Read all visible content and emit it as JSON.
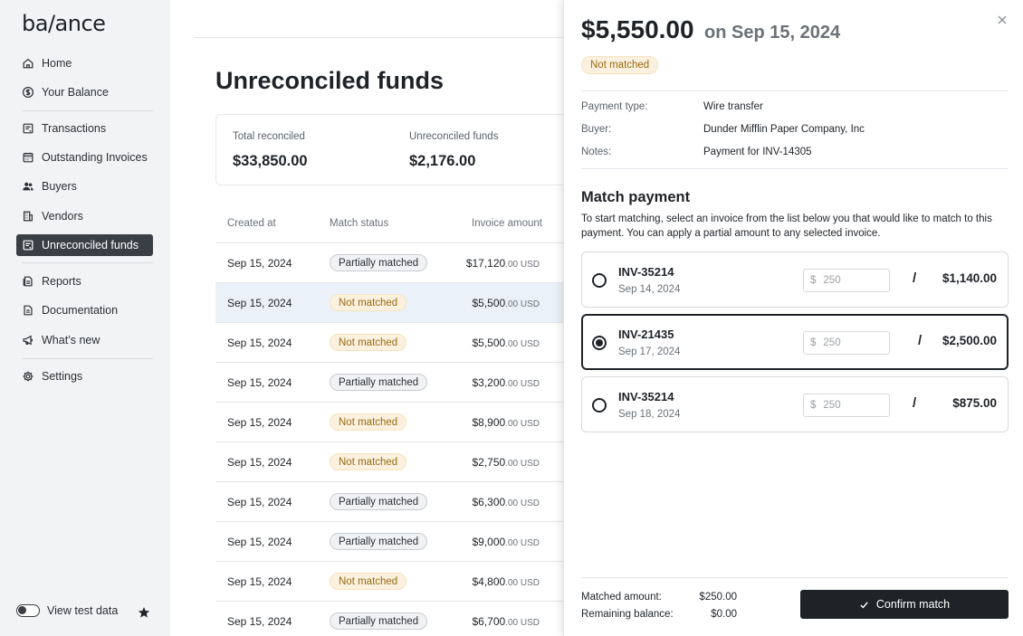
{
  "logo": "ba/ance",
  "sidebar": {
    "items": [
      {
        "label": "Home",
        "icon": "home-icon"
      },
      {
        "label": "Your Balance",
        "icon": "dollar-circle-icon"
      },
      {
        "label": "Transactions",
        "icon": "receipt-icon"
      },
      {
        "label": "Outstanding Invoices",
        "icon": "calendar-icon"
      },
      {
        "label": "Buyers",
        "icon": "users-icon"
      },
      {
        "label": "Vendors",
        "icon": "building-icon"
      },
      {
        "label": "Unreconciled funds",
        "icon": "funds-icon",
        "active": true
      },
      {
        "label": "Reports",
        "icon": "report-icon"
      },
      {
        "label": "Documentation",
        "icon": "document-icon"
      },
      {
        "label": "What’s new",
        "icon": "megaphone-icon"
      },
      {
        "label": "Settings",
        "icon": "gear-icon"
      }
    ],
    "test_data_label": "View test data"
  },
  "main": {
    "title": "Unreconciled funds",
    "stats": {
      "total_reconciled_label": "Total reconciled",
      "total_reconciled_value": "$33,850.00",
      "unreconciled_label": "Unreconciled funds",
      "unreconciled_value": "$2,176.00"
    },
    "table": {
      "headers": [
        "Created at",
        "Match status",
        "Invoice amount"
      ],
      "rows": [
        {
          "date": "Sep 15, 2024",
          "status": "Partially matched",
          "amount": "$17,120",
          "cents": ".00 USD"
        },
        {
          "date": "Sep 15, 2024",
          "status": "Not matched",
          "amount": "$5,500",
          "cents": ".00 USD"
        },
        {
          "date": "Sep 15, 2024",
          "status": "Not matched",
          "amount": "$5,500",
          "cents": ".00 USD"
        },
        {
          "date": "Sep 15, 2024",
          "status": "Partially matched",
          "amount": "$3,200",
          "cents": ".00 USD"
        },
        {
          "date": "Sep 15, 2024",
          "status": "Not matched",
          "amount": "$8,900",
          "cents": ".00 USD"
        },
        {
          "date": "Sep 15, 2024",
          "status": "Not matched",
          "amount": "$2,750",
          "cents": ".00 USD"
        },
        {
          "date": "Sep 15, 2024",
          "status": "Partially matched",
          "amount": "$6,300",
          "cents": ".00 USD"
        },
        {
          "date": "Sep 15, 2024",
          "status": "Partially matched",
          "amount": "$9,000",
          "cents": ".00 USD"
        },
        {
          "date": "Sep 15, 2024",
          "status": "Not matched",
          "amount": "$4,800",
          "cents": ".00 USD"
        },
        {
          "date": "Sep 15, 2024",
          "status": "Partially matched",
          "amount": "$6,700",
          "cents": ".00 USD"
        }
      ]
    }
  },
  "panel": {
    "amount": "$5,550.00",
    "date": "on Sep 15, 2024",
    "status": "Not matched",
    "details": [
      {
        "label": "Payment type:",
        "value": "Wire transfer"
      },
      {
        "label": "Buyer:",
        "value": "Dunder Mifflin Paper Company, Inc"
      },
      {
        "label": "Notes:",
        "value": "Payment for INV-14305"
      }
    ],
    "match_title": "Match payment",
    "match_desc": "To start matching, select an invoice from the list below you that would like to match to this payment. You can apply a partial amount to any selected invoice.",
    "invoices": [
      {
        "id": "INV-35214",
        "date": "Sep 14, 2024",
        "currency": "$",
        "placeholder": "250",
        "separator": "/",
        "total": "$1,140.00",
        "selected": false
      },
      {
        "id": "INV-21435",
        "date": "Sep 17, 2024",
        "currency": "$",
        "placeholder": "250",
        "separator": "/",
        "total": "$2,500.00",
        "selected": true
      },
      {
        "id": "INV-35214",
        "date": "Sep 18, 2024",
        "currency": "$",
        "placeholder": "250",
        "separator": "/",
        "total": "$875.00",
        "selected": false
      }
    ],
    "matched_amount_label": "Matched amount:",
    "matched_amount_value": "$250.00",
    "remaining_label": "Remaining balance:",
    "remaining_value": "$0.00",
    "confirm_label": "Confirm match"
  },
  "colors": {
    "sidebar_bg": "#f2f3f5",
    "active_nav": "#3a3f45",
    "not_matched_bg": "#fbf1de",
    "not_matched_text": "#9a6a14",
    "selected_row": "#eaf1f8",
    "primary_button": "#1f2328"
  }
}
